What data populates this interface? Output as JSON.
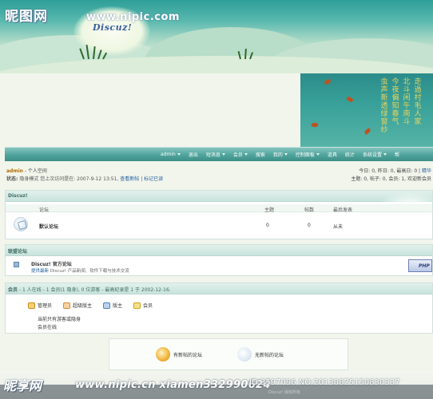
{
  "watermark": {
    "site_cn": "昵图网",
    "site_url": "www.nipic.com",
    "bottom_logo": "昵享网",
    "bottom_url": "www.nipic.cn",
    "bottom_user": "xiamen332990624",
    "bottom_id": "ID:3597096 NO:20130825150830337",
    "bottom_tiny": "Discuz! 版权所有"
  },
  "banner": {
    "logo": "Discuz!"
  },
  "poem": {
    "columns": [
      "走過村毛人家",
      "北斗闲午南斗",
      "今夜偏知春气",
      "虫声新透绿窗纱"
    ]
  },
  "nav": {
    "items": [
      {
        "label": "admin",
        "dropdown": true
      },
      {
        "label": "退出",
        "dropdown": false
      },
      {
        "label": "短消息",
        "dropdown": true
      },
      {
        "label": "会员",
        "dropdown": true
      },
      {
        "label": "搜索",
        "dropdown": false
      },
      {
        "label": "我的",
        "dropdown": true
      },
      {
        "label": "控制面板",
        "dropdown": true
      },
      {
        "label": "道具",
        "dropdown": false
      },
      {
        "label": "统计",
        "dropdown": false
      },
      {
        "label": "系统设置",
        "dropdown": true
      },
      {
        "label": "帮",
        "dropdown": false
      }
    ]
  },
  "userbar": {
    "username": "admin",
    "personal_space": "- 个人空间",
    "status_label": "状态:",
    "status_text": "隐身模式 您上次访问是在: 2007-9-12 13:51,",
    "view_new": "查看新帖",
    "separator": "|",
    "mark_read": "标记已读",
    "right1_prefix": "今日: 0, 昨日: 0, 最高日: 0 |",
    "right1_link": "精华",
    "right2": "主题: 0, 帖子: 0, 会员: 1, 欢迎新会员"
  },
  "forum_section": {
    "title": "Discuz!",
    "columns": [
      "论坛",
      "主题",
      "帖数",
      "最后发表"
    ],
    "rows": [
      {
        "name": "默认论坛",
        "topics": "0",
        "posts": "0",
        "last": "从未"
      }
    ]
  },
  "league_section": {
    "title": "联盟论坛",
    "name": "Discuz! 官方论坛",
    "desc_link": "提供最新",
    "desc_rest": "Discuz! 产品新闻、软件下载与技术交流",
    "php_logo": "PHP"
  },
  "members_section": {
    "title": "会员",
    "summary": "- 1 人在线 - 1 会员(1 隐身), 0 位游客 - 最高纪录是 1 于 2002-12-16.",
    "roles": [
      {
        "label": "管理员",
        "color": "#e0a030"
      },
      {
        "label": "超级版主",
        "color": "#e8a858"
      },
      {
        "label": "版主",
        "color": "#6a9ccc"
      },
      {
        "label": "会员",
        "color": "#e8c040"
      }
    ],
    "hidden_note": "当前只有游客或隐身",
    "online_note": "会员在线"
  },
  "legend": {
    "new_posts": "有新帖的论坛",
    "no_new_posts": "无新帖的论坛"
  }
}
